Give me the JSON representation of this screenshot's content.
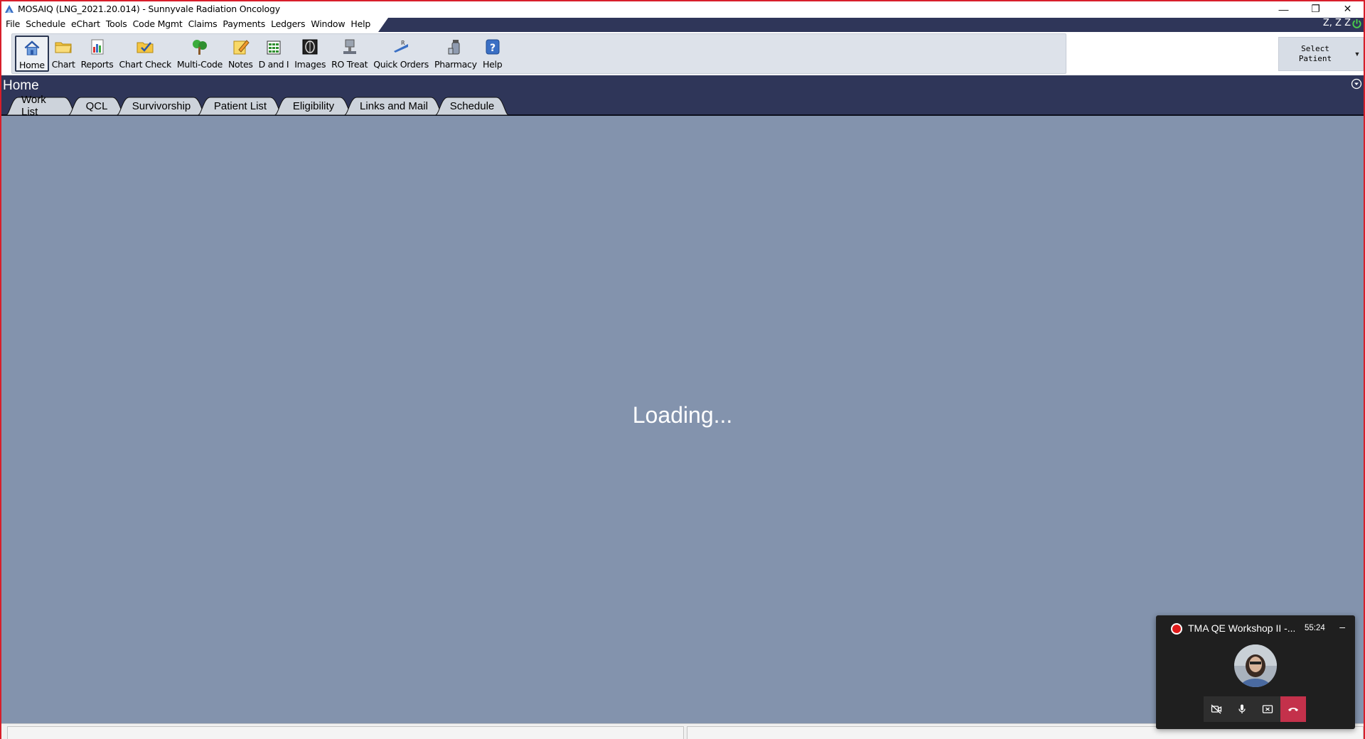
{
  "window": {
    "title": "MOSAIQ (LNG_2021.20.014) - Sunnyvale Radiation Oncology",
    "minimize": "—",
    "restore": "❐",
    "close": "✕"
  },
  "menu": {
    "items": [
      "File",
      "Schedule",
      "eChart",
      "Tools",
      "Code Mgmt",
      "Claims",
      "Payments",
      "Ledgers",
      "Window",
      "Help"
    ],
    "user": "Z, Z Z"
  },
  "toolbar": {
    "buttons": [
      {
        "label": "Home",
        "icon": "home-icon",
        "active": true
      },
      {
        "label": "Chart",
        "icon": "chart-folder-icon"
      },
      {
        "label": "Reports",
        "icon": "reports-icon"
      },
      {
        "label": "Chart Check",
        "icon": "chart-check-icon"
      },
      {
        "label": "Multi-Code",
        "icon": "multi-code-icon"
      },
      {
        "label": "Notes",
        "icon": "notes-icon"
      },
      {
        "label": "D and I",
        "icon": "d-and-i-icon"
      },
      {
        "label": "Images",
        "icon": "images-icon"
      },
      {
        "label": "RO Treat",
        "icon": "ro-treat-icon"
      },
      {
        "label": "Quick Orders",
        "icon": "quick-orders-icon"
      },
      {
        "label": "Pharmacy",
        "icon": "pharmacy-icon"
      },
      {
        "label": "Help",
        "icon": "help-icon"
      }
    ],
    "select_patient": "Select\nPatient"
  },
  "home": {
    "title": "Home",
    "tabs": [
      "Work List",
      "QCL",
      "Survivorship",
      "Patient List",
      "Eligibility",
      "Links and Mail",
      "Schedule"
    ],
    "active_tab": "Work List"
  },
  "content": {
    "loading_text": "Loading..."
  },
  "call": {
    "title": "TMA QE Workshop II -...",
    "time": "55:24",
    "minimize": "–"
  },
  "colors": {
    "header_navy": "#2f3659",
    "content_bg": "#8393ad",
    "tab_bg": "#cdd3db",
    "frame_red": "#d81e2a",
    "end_call_red": "#c4314b"
  }
}
